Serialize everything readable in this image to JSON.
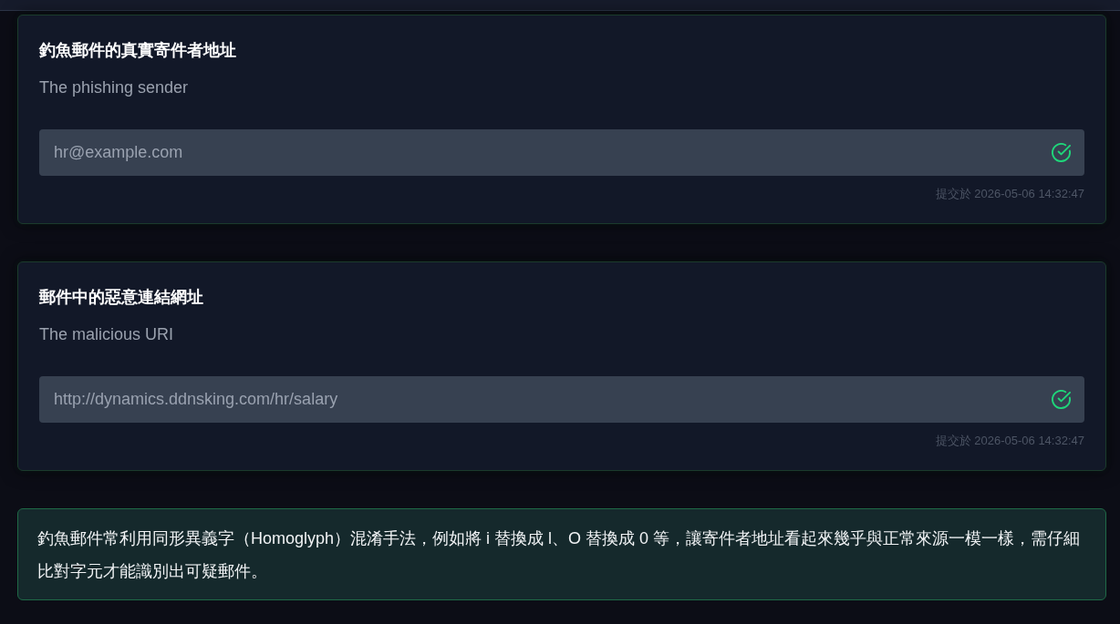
{
  "questions": [
    {
      "title": "釣魚郵件的真實寄件者地址",
      "subtitle": "The phishing sender",
      "answer": "hr@example.com",
      "correct": true,
      "submitted": "提交於 2026-05-06 14:32:47"
    },
    {
      "title": "郵件中的惡意連結網址",
      "subtitle": "The malicious URI",
      "answer": "http://dynamics.ddnsking.com/hr/salary",
      "correct": true,
      "submitted": "提交於 2026-05-06 14:32:47"
    }
  ],
  "note": {
    "text": "釣魚郵件常利用同形異義字（Homoglyph）混淆手法，例如將 i 替換成 l、O 替換成 0 等，讓寄件者地址看起來幾乎與正常來源一模一樣，需仔細比對字元才能識別出可疑郵件。"
  }
}
